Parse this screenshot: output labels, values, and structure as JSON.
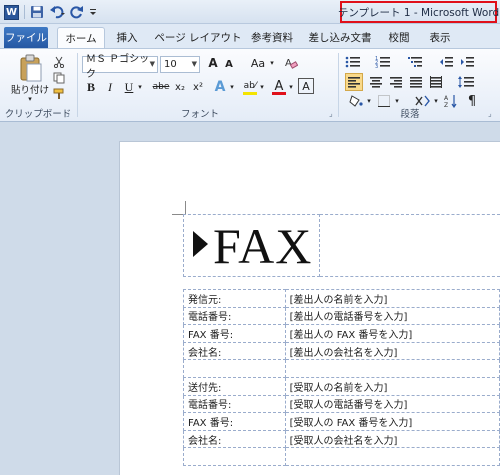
{
  "window": {
    "title": "テンプレート 1 - Microsoft Word",
    "qat": {
      "word_icon": "word-logo-icon",
      "save_icon": "save-icon",
      "undo_icon": "undo-icon",
      "redo_icon": "redo-icon",
      "customize_icon": "customize-qat-icon"
    }
  },
  "tabs": [
    {
      "label": "ファイル"
    },
    {
      "label": "ホーム"
    },
    {
      "label": "挿入"
    },
    {
      "label": "ページ レイアウト"
    },
    {
      "label": "参考資料"
    },
    {
      "label": "差し込み文書"
    },
    {
      "label": "校閲"
    },
    {
      "label": "表示"
    }
  ],
  "ribbon": {
    "clipboard": {
      "label": "クリップボード",
      "paste_label": "貼り付け"
    },
    "font": {
      "label": "フォント",
      "font_name": "ＭＳ Ｐゴシック",
      "font_size": "10",
      "grow_label": "A",
      "shrink_label": "A",
      "case_label": "Aa",
      "bold": "B",
      "italic": "I",
      "underline": "U",
      "strike": "abe",
      "subscript": "x₂",
      "superscript": "x²",
      "text_effect": "A",
      "highlight": "ab⁄",
      "font_color": "A",
      "char_border": "A"
    },
    "paragraph": {
      "label": "段落"
    },
    "colors": {
      "highlight": "#f4e400",
      "font_color": "#e0101a",
      "accent": "#2b579a"
    }
  },
  "document": {
    "fax_title": "FAX",
    "sender_rows": [
      {
        "label": "発信元:",
        "value": "[差出人の名前を入力]"
      },
      {
        "label": "電話番号:",
        "value": "[差出人の電話番号を入力]"
      },
      {
        "label": "FAX 番号:",
        "value": "[差出人の FAX 番号を入力]"
      },
      {
        "label": "会社名:",
        "value": "[差出人の会社名を入力]"
      },
      {
        "label": "",
        "value": ""
      }
    ],
    "recipient_rows": [
      {
        "label": "送付先:",
        "value": "[受取人の名前を入力]"
      },
      {
        "label": "電話番号:",
        "value": "[受取人の電話番号を入力]"
      },
      {
        "label": "FAX 番号:",
        "value": "[受取人の FAX 番号を入力]"
      },
      {
        "label": "会社名:",
        "value": "[受取人の会社名を入力]"
      },
      {
        "label": "",
        "value": ""
      }
    ]
  }
}
